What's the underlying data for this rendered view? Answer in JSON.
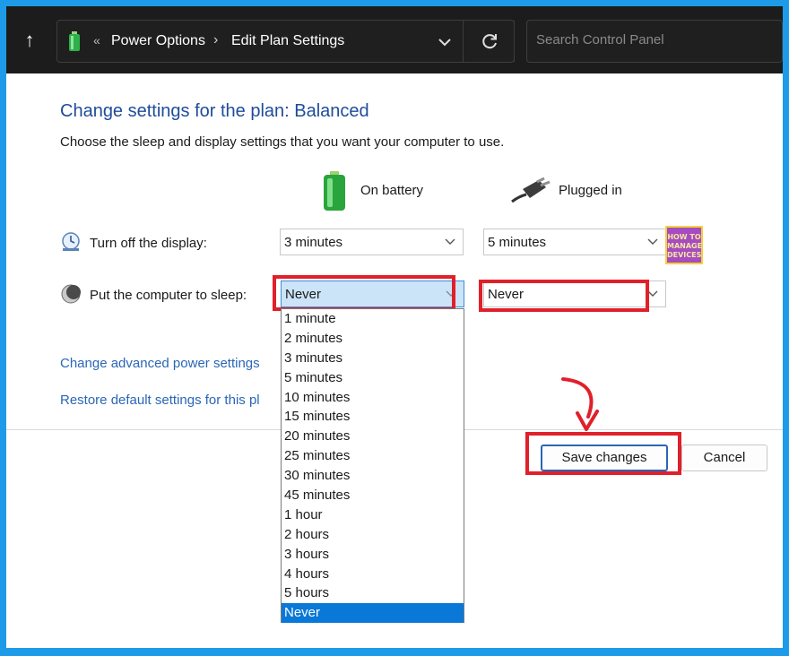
{
  "addressbar": {
    "separator": "«",
    "crumbs": [
      "Power Options",
      "Edit Plan Settings"
    ],
    "chevron": "›",
    "search_placeholder": "Search Control Panel"
  },
  "page": {
    "title": "Change settings for the plan: Balanced",
    "subtitle": "Choose the sleep and display settings that you want your computer to use."
  },
  "columns": {
    "battery": "On battery",
    "plugged": "Plugged in"
  },
  "rows": {
    "display": {
      "label": "Turn off the display:",
      "battery_value": "3 minutes",
      "plugged_value": "5 minutes"
    },
    "sleep": {
      "label": "Put the computer to sleep:",
      "battery_value": "Never",
      "plugged_value": "Never"
    }
  },
  "dropdown_options": [
    "1 minute",
    "2 minutes",
    "3 minutes",
    "5 minutes",
    "10 minutes",
    "15 minutes",
    "20 minutes",
    "25 minutes",
    "30 minutes",
    "45 minutes",
    "1 hour",
    "2 hours",
    "3 hours",
    "4 hours",
    "5 hours",
    "Never"
  ],
  "dropdown_selected": "Never",
  "links": {
    "advanced": "Change advanced power settings",
    "restore": "Restore default settings for this pl"
  },
  "buttons": {
    "save": "Save changes",
    "cancel": "Cancel"
  },
  "badge": {
    "lines": [
      "HOW TO",
      "MANAGE",
      "DEVICES"
    ]
  },
  "colors": {
    "highlight": "#e0202a",
    "accent": "#1e4c9a",
    "link": "#2a66b6",
    "selection": "#0a78d7",
    "border_frame": "#1e9be8"
  },
  "icons": {
    "up": "up-arrow-icon",
    "address": "battery-icon",
    "refresh": "refresh-icon",
    "display": "display-timer-icon",
    "sleep": "sleep-moon-icon",
    "battery": "battery-icon",
    "plug": "power-plug-icon"
  }
}
